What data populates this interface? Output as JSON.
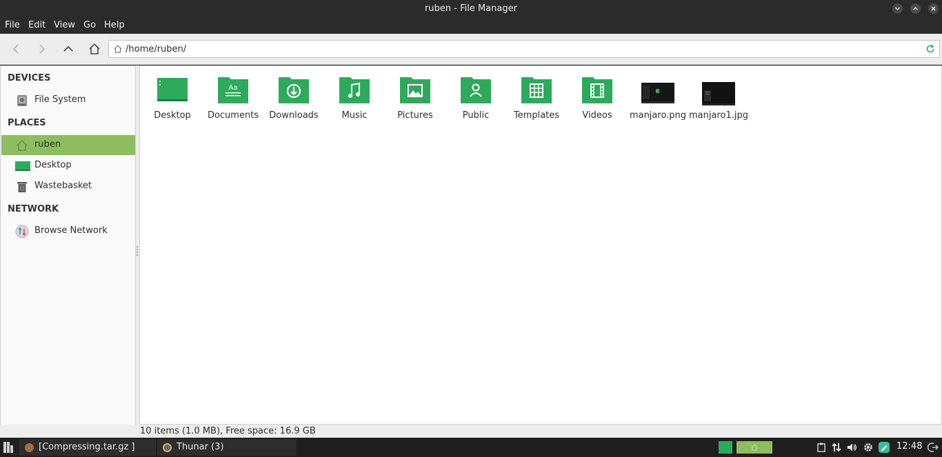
{
  "window": {
    "title": "ruben - File Manager",
    "controls": [
      "minimize-icon",
      "maximize-icon",
      "close-icon"
    ]
  },
  "menubar": {
    "items": [
      "File",
      "Edit",
      "View",
      "Go",
      "Help"
    ]
  },
  "toolbar": {
    "back_icon": "chevron-left-icon",
    "forward_icon": "chevron-right-icon",
    "up_icon": "chevron-up-icon",
    "home_icon": "home-icon",
    "location": "/home/ruben/",
    "reload_icon": "reload-icon"
  },
  "sidebar": {
    "devices_heading": "DEVICES",
    "devices": [
      {
        "label": "File System",
        "icon": "harddisk-icon"
      }
    ],
    "places_heading": "PLACES",
    "places": [
      {
        "label": "ruben",
        "icon": "home-icon",
        "active": true
      },
      {
        "label": "Desktop",
        "icon": "desktop-icon"
      },
      {
        "label": "Wastebasket",
        "icon": "trash-icon"
      }
    ],
    "network_heading": "NETWORK",
    "network": [
      {
        "label": "Browse Network",
        "icon": "network-icon"
      }
    ]
  },
  "files": [
    {
      "name": "Desktop",
      "icon": "desktop-folder-icon"
    },
    {
      "name": "Documents",
      "icon": "documents-folder-icon"
    },
    {
      "name": "Downloads",
      "icon": "downloads-folder-icon"
    },
    {
      "name": "Music",
      "icon": "music-folder-icon"
    },
    {
      "name": "Pictures",
      "icon": "pictures-folder-icon"
    },
    {
      "name": "Public",
      "icon": "public-folder-icon"
    },
    {
      "name": "Templates",
      "icon": "templates-folder-icon"
    },
    {
      "name": "Videos",
      "icon": "videos-folder-icon"
    },
    {
      "name": "manjaro.png",
      "icon": "image-thumbnail"
    },
    {
      "name": "manjaro1.jpg",
      "icon": "image-thumbnail"
    }
  ],
  "statusbar": {
    "text": "10 items (1.0 MB), Free space: 16.9 GB"
  },
  "taskbar": {
    "tasks": [
      {
        "label": "[Compressing.tar.gz ]"
      },
      {
        "label": "Thunar (3)"
      }
    ],
    "clock": "12:48"
  },
  "colors": {
    "accent": "#2eaa5c",
    "selection": "#8ebd5f",
    "titlebar": "#2b2b2b"
  }
}
